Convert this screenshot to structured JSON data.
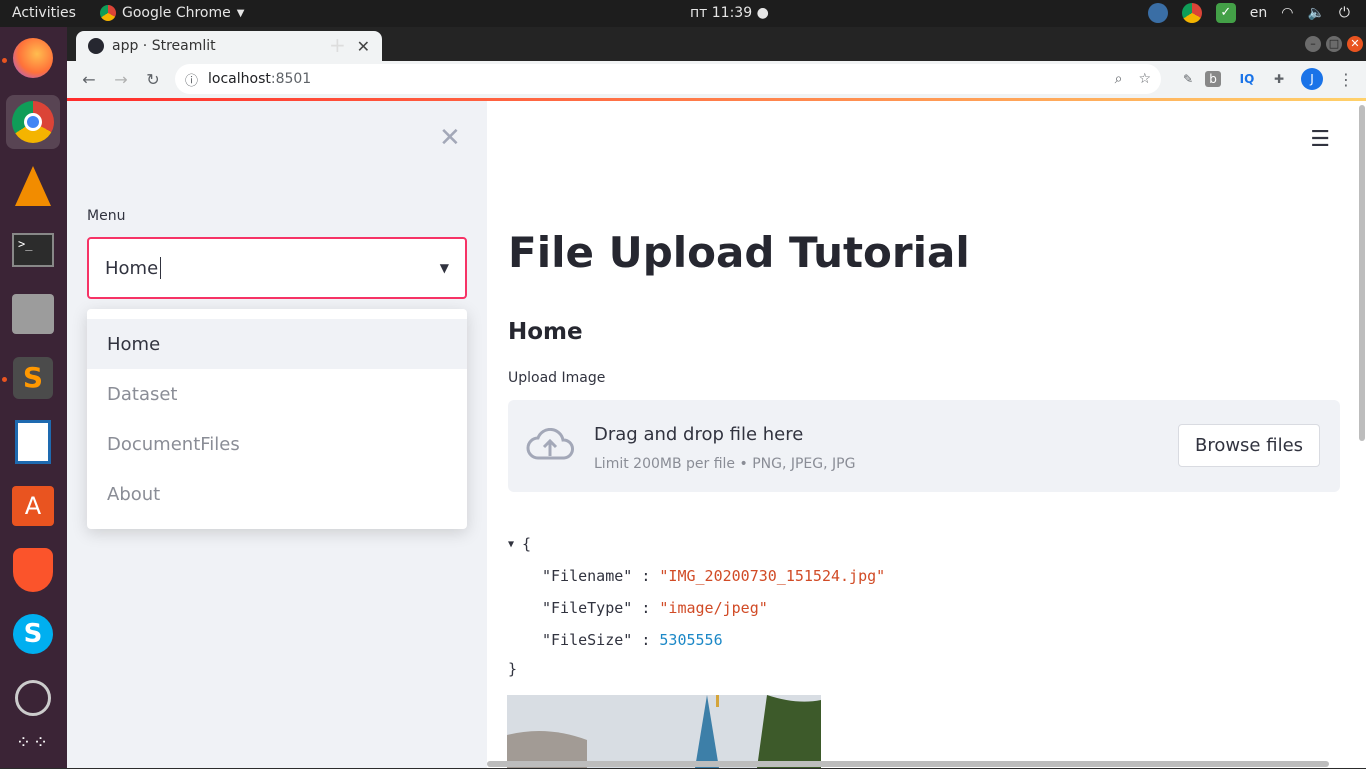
{
  "topbar": {
    "activities": "Activities",
    "app_name": "Google Chrome",
    "clock": "пт 11:39",
    "lang": "en"
  },
  "browser": {
    "tab_title": "app · Streamlit",
    "url_host": "localhost",
    "url_port": ":8501",
    "profile_initial": "J",
    "ext_iq": "IQ"
  },
  "sidebar": {
    "label": "Menu",
    "selected": "Home",
    "options": [
      "Home",
      "Dataset",
      "DocumentFiles",
      "About"
    ]
  },
  "main": {
    "title": "File Upload Tutorial",
    "subheader": "Home",
    "uploader_label": "Upload Image",
    "dropzone_title": "Drag and drop file here",
    "dropzone_sub": "Limit 200MB per file • PNG, JPEG, JPG",
    "browse_label": "Browse files",
    "json": {
      "open": "{",
      "close": "}",
      "rows": [
        {
          "key": "\"Filename\"",
          "value": "\"IMG_20200730_151524.jpg\"",
          "type": "str"
        },
        {
          "key": "\"FileType\"",
          "value": "\"image/jpeg\"",
          "type": "str"
        },
        {
          "key": "\"FileSize\"",
          "value": "5305556",
          "type": "num"
        }
      ]
    }
  },
  "colors": {
    "accent": "#f63366",
    "json_string": "#d14b26",
    "json_number": "#1c88c7"
  }
}
